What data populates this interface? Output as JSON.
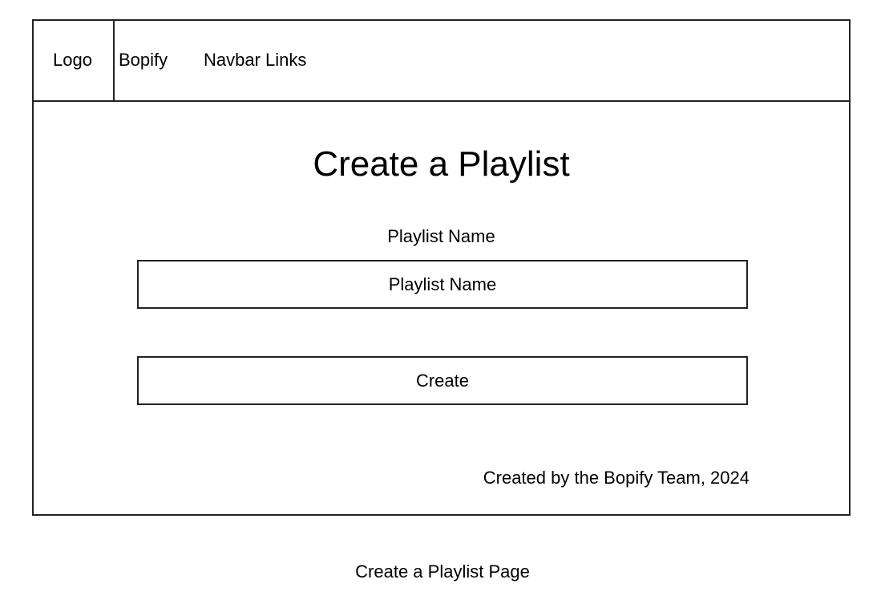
{
  "navbar": {
    "logo": "Logo",
    "brand": "Bopify",
    "links": "Navbar Links"
  },
  "main": {
    "title": "Create a Playlist",
    "field_label": "Playlist Name",
    "name_placeholder": "Playlist Name",
    "create_label": "Create"
  },
  "footer": {
    "text": "Created by the Bopify Team, 2024"
  },
  "caption": "Create a Playlist Page",
  "colors": {
    "border": "#222222",
    "background": "#ffffff",
    "text": "#000000"
  }
}
